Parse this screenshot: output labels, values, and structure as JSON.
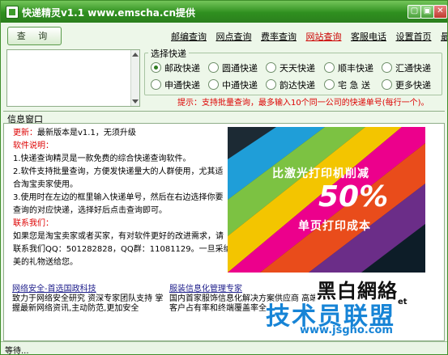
{
  "window": {
    "title": "快递精灵v1.1 www.emscha.cn提供",
    "minimize": "▢",
    "maximize": "▣",
    "close": "✕"
  },
  "toolbar": {
    "query_label": "查 询"
  },
  "menu": [
    "邮编查询",
    "网点查询",
    "费率查询",
    "网站查询",
    "客服电话",
    "设置首页",
    "最新版本"
  ],
  "couriers": {
    "legend": "选择快递",
    "options": [
      "邮政快递",
      "圆通快递",
      "天天快递",
      "顺丰快递",
      "汇通快递",
      "申通快递",
      "中通快递",
      "韵达快递",
      "宅 急 送",
      "更多快递"
    ],
    "selected": "邮政快递"
  },
  "hint": "提示：支持批量查询，最多输入10个同一公司的快递单号(每行一个)。",
  "info": {
    "header": "信息窗口",
    "update_label": "更新：",
    "update_text": "最新版本是v1.1，无须升级",
    "usage_title": "软件说明：",
    "usage_1": "1.快递查询精灵是一款免费的综合快递查询软件。",
    "usage_2a": "2.软件支持批量查询，方便发快递量大的人群使用，尤其适",
    "usage_2b": "合淘宝卖家使用。",
    "usage_3a": "3.使用时在左边的框里输入快递单号，然后在右边选择你要",
    "usage_3b": "查询的对应快递，选择好后点击查询即可。",
    "contact_title": "联系我们：",
    "contact_1": "如果您是淘宝卖家或者买家，有对软件更好的改进需求，请",
    "contact_2": "联系我们QQ：501282828，QQ群：11081129。一旦采纳，有精",
    "contact_3": "美的礼物送给您。"
  },
  "ad": {
    "line1": "比激光打印机削减",
    "line2": "50%",
    "line3": "单页打印成本"
  },
  "links": {
    "left_title": "网络安全-首选国政科技",
    "left_1": "致力于网络安全研究 资深专家团队支持 掌",
    "left_2": "握最新网络资讯,主动防范,更加安全",
    "right_title": "服装信息化管理专家",
    "right_1": "国内首家服饰信息化解决方案供应商 高端",
    "right_2": "客户占有率和终端覆盖率全"
  },
  "logo": {
    "text": "黑白網絡",
    "sub": "et"
  },
  "watermark": {
    "main": "技术员联盟",
    "url": "www.jsgho.com"
  },
  "status": "等待..."
}
